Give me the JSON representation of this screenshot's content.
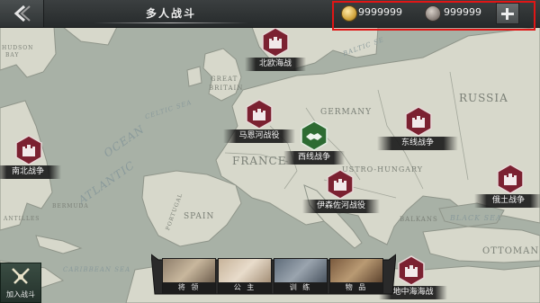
{
  "header": {
    "title": "多人战斗",
    "gold": "9999999",
    "silver": "999999"
  },
  "map_labels": {
    "russia": "RUSSIA",
    "germany": "GERMANY",
    "france": "FRANCE",
    "spain": "SPAIN",
    "austro_hungary": "USTRO-HUNGARY",
    "great_britain_1": "GREAT",
    "great_britain_2": "BRITAIN",
    "atlantic_1": "ATLANTIC",
    "atlantic_2": "OCEAN",
    "celtic_sea": "CELTIC SEA",
    "black_sea": "BLACK SEA",
    "ottoman": "OTTOMAN",
    "balkans": "BALKANS",
    "baltic_sea": "BALTIC SE",
    "portugal": "PORTUGAL",
    "hudson_1": "HUDSON",
    "hudson_2": "BAY",
    "bermuda": "BERMUDA",
    "caribbean_sea": "CARIBBEAN SEA",
    "antilles": "ANTILLES"
  },
  "battles": [
    {
      "name": "北欧海战"
    },
    {
      "name": "马恩河战役"
    },
    {
      "name": "西线战争"
    },
    {
      "name": "东线战争"
    },
    {
      "name": "南北战争"
    },
    {
      "name": "伊森佐河战役"
    },
    {
      "name": "俄土战争"
    },
    {
      "name": "地中海海战"
    }
  ],
  "bottom": {
    "join_label": "加入战斗",
    "menu": [
      {
        "label": "将 领"
      },
      {
        "label": "公 主"
      },
      {
        "label": "训 练"
      },
      {
        "label": "物 品"
      }
    ]
  },
  "colors": {
    "land": "#d8d9cc",
    "sea": "#a7b1a6",
    "marker": "#7a2030",
    "marker_active": "#2f6b2f",
    "highlight": "#e01616"
  }
}
